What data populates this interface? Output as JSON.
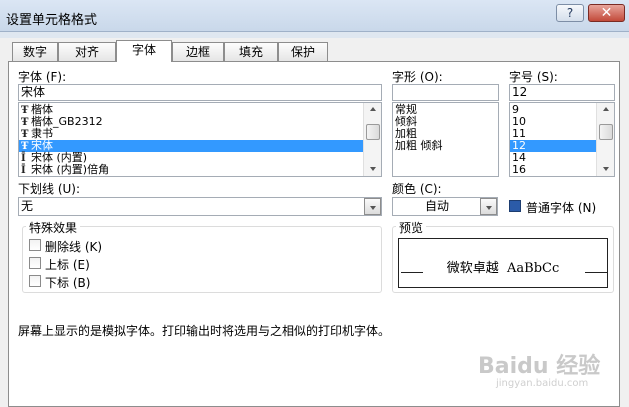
{
  "window": {
    "title": "设置单元格格式",
    "help_label": "?",
    "close_label": "✕"
  },
  "tabs": [
    {
      "label": "数字"
    },
    {
      "label": "对齐"
    },
    {
      "label": "字体"
    },
    {
      "label": "边框"
    },
    {
      "label": "填充"
    },
    {
      "label": "保护"
    }
  ],
  "font": {
    "label": "字体 (F):",
    "value": "宋体",
    "items": [
      {
        "icon": "Ŧ",
        "name": "楷体"
      },
      {
        "icon": "Ŧ",
        "name": "楷体_GB2312"
      },
      {
        "icon": "Ŧ",
        "name": "隶书"
      },
      {
        "icon": "Ŧ",
        "name": "宋体"
      },
      {
        "icon": "Ī",
        "name": "宋体 (内置)"
      },
      {
        "icon": "Ī",
        "name": "宋体 (内置)倍角"
      }
    ],
    "selected_index": 3
  },
  "style": {
    "label": "字形 (O):",
    "value": "",
    "items": [
      "常规",
      "倾斜",
      "加粗",
      "加粗 倾斜"
    ]
  },
  "size": {
    "label": "字号 (S):",
    "value": "12",
    "items": [
      "9",
      "10",
      "11",
      "12",
      "14",
      "16"
    ],
    "selected_index": 3
  },
  "underline": {
    "label": "下划线 (U):",
    "value": "无"
  },
  "color": {
    "label": "颜色 (C):",
    "value": "自动",
    "normal_font_label": "普通字体 (N)",
    "normal_font_checked": true
  },
  "effects": {
    "title": "特殊效果",
    "items": [
      {
        "label": "删除线 (K)",
        "checked": false
      },
      {
        "label": "上标 (E)",
        "checked": false
      },
      {
        "label": "下标 (B)",
        "checked": false
      }
    ]
  },
  "preview": {
    "title": "预览",
    "sample": "微软卓越  AaBbCc"
  },
  "note": "屏幕上显示的是模拟字体。打印输出时将选用与之相似的打印机字体。",
  "watermark": {
    "brand": "Baidu 经验",
    "url": "jingyan.baidu.com"
  },
  "colors": {
    "selection": "#3399ff",
    "close_button": "#c24a3a"
  }
}
